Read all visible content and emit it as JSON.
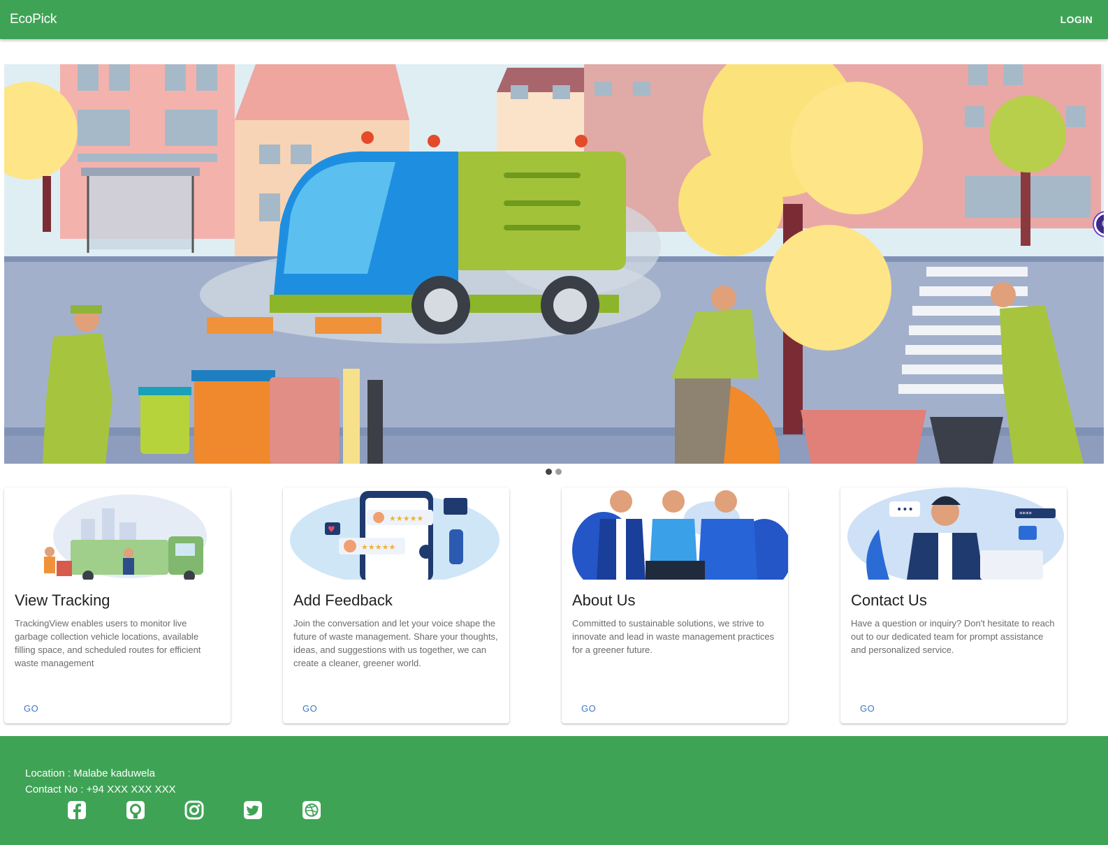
{
  "appbar": {
    "brand": "EcoPick",
    "login_label": "LOGIN"
  },
  "carousel": {
    "slide_count": 2,
    "active_index": 0
  },
  "cards": [
    {
      "title": "View Tracking",
      "description": "TrackingView enables users to monitor live garbage collection vehicle locations, available filling space, and scheduled routes for efficient waste management",
      "action": "GO"
    },
    {
      "title": "Add Feedback",
      "description": "Join the conversation and let your voice shape the future of waste management. Share your thoughts, ideas, and suggestions with us together, we can create a cleaner, greener world.",
      "action": "GO"
    },
    {
      "title": "About Us",
      "description": "Committed to sustainable solutions, we strive to innovate and lead in waste management practices for a greener future.",
      "action": "GO"
    },
    {
      "title": "Contact Us",
      "description": "Have a question or inquiry? Don't hesitate to reach out to our dedicated team for prompt assistance and personalized service.",
      "action": "GO"
    }
  ],
  "footer": {
    "location": "Location : Malabe kaduwela",
    "contact": "Contact No : +94 XXX XXX XXX",
    "socials": [
      "facebook-icon",
      "github-icon",
      "instagram-icon",
      "twitter-icon",
      "dribbble-icon"
    ]
  },
  "colors": {
    "primary": "#3fa356",
    "link": "#3c78c2"
  }
}
